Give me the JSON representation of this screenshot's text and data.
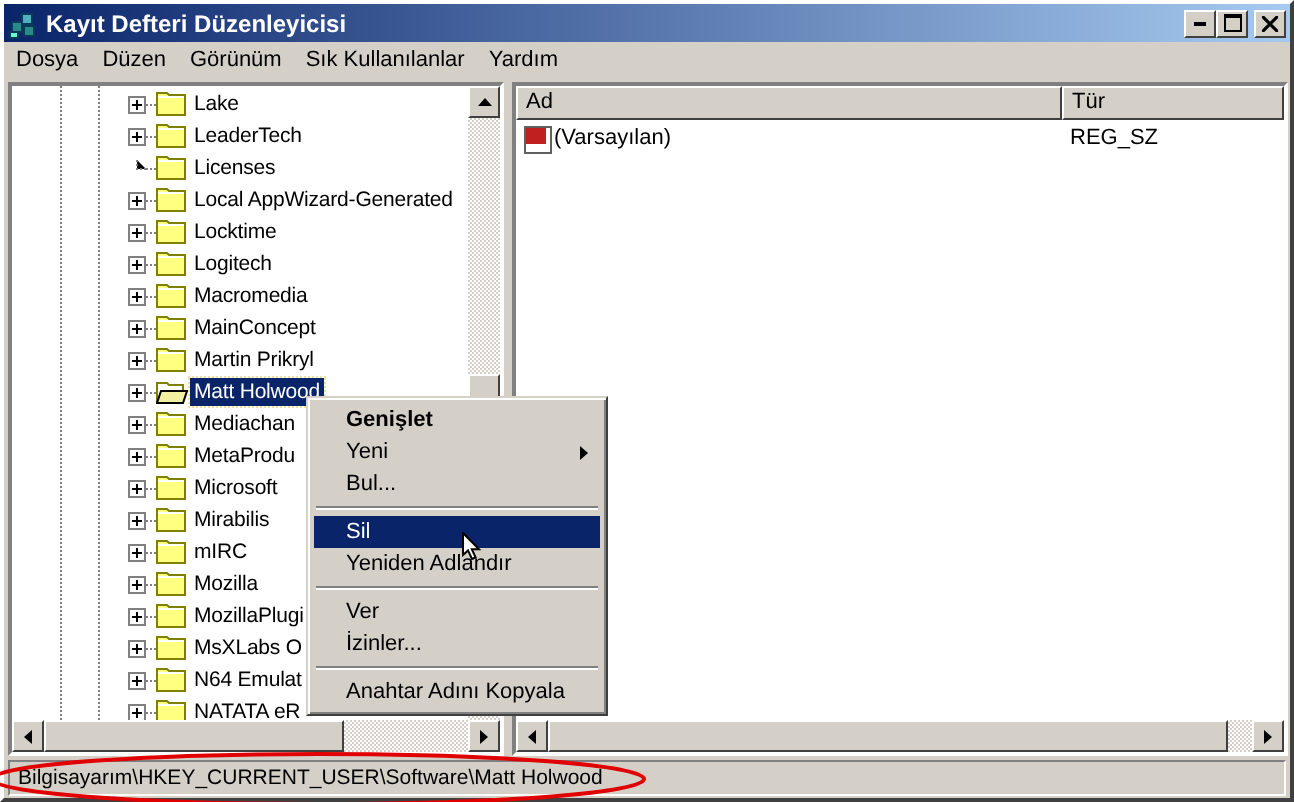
{
  "window": {
    "title": "Kayıt Defteri Düzenleyicisi"
  },
  "menu": [
    "Dosya",
    "Düzen",
    "Görünüm",
    "Sık Kullanılanlar",
    "Yardım"
  ],
  "tree": {
    "items": [
      {
        "label": "Lake",
        "expandable": true,
        "selected": false
      },
      {
        "label": "LeaderTech",
        "expandable": true,
        "selected": false
      },
      {
        "label": "Licenses",
        "expandable": false,
        "selected": false
      },
      {
        "label": "Local AppWizard-Generated",
        "expandable": true,
        "selected": false
      },
      {
        "label": "Locktime",
        "expandable": true,
        "selected": false
      },
      {
        "label": "Logitech",
        "expandable": true,
        "selected": false
      },
      {
        "label": "Macromedia",
        "expandable": true,
        "selected": false
      },
      {
        "label": "MainConcept",
        "expandable": true,
        "selected": false
      },
      {
        "label": "Martin Prikryl",
        "expandable": true,
        "selected": false
      },
      {
        "label": "Matt Holwood",
        "expandable": true,
        "selected": true
      },
      {
        "label": "Mediachan",
        "expandable": true,
        "selected": false
      },
      {
        "label": "MetaProdu",
        "expandable": true,
        "selected": false
      },
      {
        "label": "Microsoft",
        "expandable": true,
        "selected": false
      },
      {
        "label": "Mirabilis",
        "expandable": true,
        "selected": false
      },
      {
        "label": "mIRC",
        "expandable": true,
        "selected": false
      },
      {
        "label": "Mozilla",
        "expandable": true,
        "selected": false
      },
      {
        "label": "MozillaPlugi",
        "expandable": true,
        "selected": false
      },
      {
        "label": "MsXLabs O",
        "expandable": true,
        "selected": false
      },
      {
        "label": "N64 Emulat",
        "expandable": true,
        "selected": false
      },
      {
        "label": "NATATA eR",
        "expandable": true,
        "selected": false
      }
    ]
  },
  "values": {
    "columns": [
      "Ad",
      "Tür"
    ],
    "rows": [
      {
        "name": "(Varsayılan)",
        "type": "REG_SZ"
      }
    ]
  },
  "context_menu": {
    "items": [
      {
        "kind": "item",
        "label": "Genişlet",
        "default": true,
        "submenu": false,
        "selected": false
      },
      {
        "kind": "item",
        "label": "Yeni",
        "default": false,
        "submenu": true,
        "selected": false
      },
      {
        "kind": "item",
        "label": "Bul...",
        "default": false,
        "submenu": false,
        "selected": false
      },
      {
        "kind": "separator"
      },
      {
        "kind": "item",
        "label": "Sil",
        "default": false,
        "submenu": false,
        "selected": true
      },
      {
        "kind": "item",
        "label": "Yeniden Adlandır",
        "default": false,
        "submenu": false,
        "selected": false
      },
      {
        "kind": "separator"
      },
      {
        "kind": "item",
        "label": "Ver",
        "default": false,
        "submenu": false,
        "selected": false
      },
      {
        "kind": "item",
        "label": "İzinler...",
        "default": false,
        "submenu": false,
        "selected": false
      },
      {
        "kind": "separator"
      },
      {
        "kind": "item",
        "label": "Anahtar Adını Kopyala",
        "default": false,
        "submenu": false,
        "selected": false
      }
    ]
  },
  "status_bar": {
    "path": "Bilgisayarım\\HKEY_CURRENT_USER\\Software\\Matt Holwood"
  }
}
